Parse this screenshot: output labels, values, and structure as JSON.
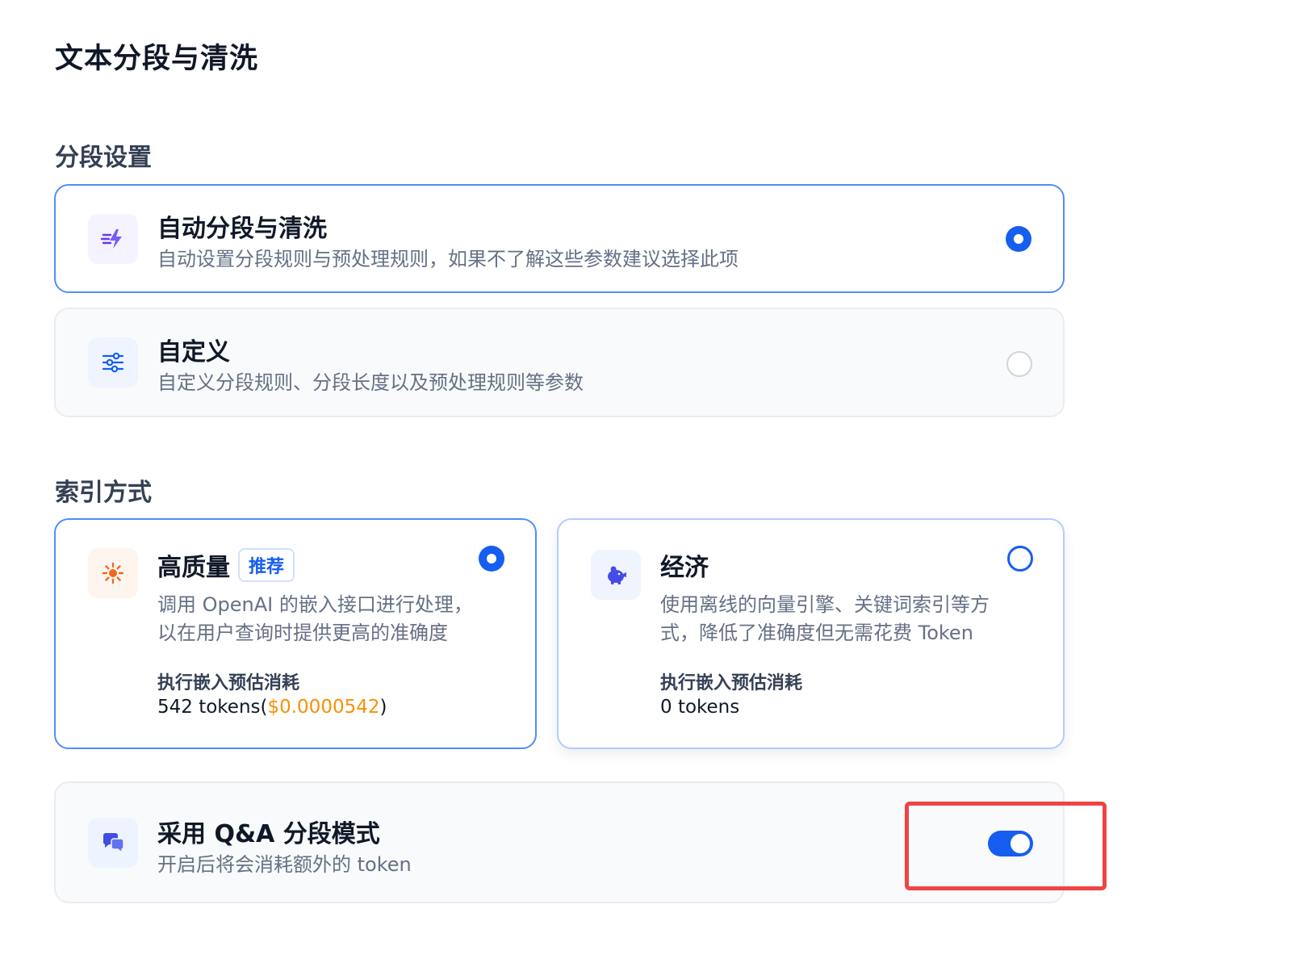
{
  "page_title": "文本分段与清洗",
  "segment_settings": {
    "title": "分段设置",
    "options": [
      {
        "label": "自动分段与清洗",
        "description": "自动设置分段规则与预处理规则，如果不了解这些参数建议选择此项",
        "selected": true,
        "icon": "lightning-icon"
      },
      {
        "label": "自定义",
        "description": "自定义分段规则、分段长度以及预处理规则等参数",
        "selected": false,
        "icon": "sliders-icon"
      }
    ]
  },
  "index_method": {
    "title": "索引方式",
    "options": [
      {
        "label": "高质量",
        "badge": "推荐",
        "description_line1": "调用 OpenAI 的嵌入接口进行处理，",
        "description_line2": "以在用户查询时提供更高的准确度",
        "cost_label": "执行嵌入预估消耗",
        "cost_tokens": "542 tokens(",
        "cost_price": "$0.0000542",
        "cost_suffix": ")",
        "selected": true,
        "icon": "sun-icon"
      },
      {
        "label": "经济",
        "description_line1": "使用离线的向量引擎、关键词索引等方",
        "description_line2": "式，降低了准确度但无需花费 Token",
        "cost_label": "执行嵌入预估消耗",
        "cost_tokens": "0 tokens",
        "selected": false,
        "icon": "piggy-bank-icon"
      }
    ]
  },
  "qa_mode": {
    "label": "采用 Q&A 分段模式",
    "description": "开启后将会消耗额外的 token",
    "enabled": true,
    "icon": "chat-bubbles-icon"
  },
  "colors": {
    "accent": "#155eef",
    "price": "#f79009",
    "highlight": "#ef4444"
  }
}
